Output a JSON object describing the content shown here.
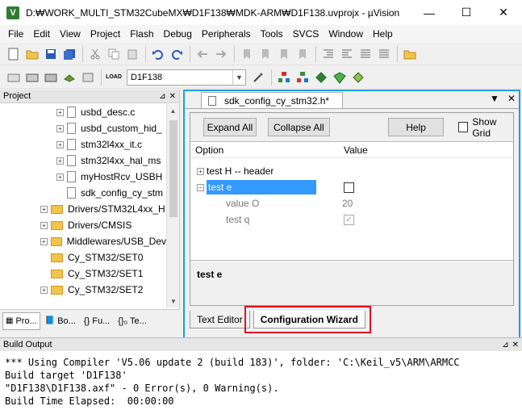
{
  "window": {
    "app_icon": "V",
    "title": "D:₩WORK_MULTI_STM32CubeMX₩D1F138₩MDK-ARM₩D1F138.uvprojx - µVision",
    "minimize": "—",
    "maximize": "☐",
    "close": "✕"
  },
  "menu": [
    "File",
    "Edit",
    "View",
    "Project",
    "Flash",
    "Debug",
    "Peripherals",
    "Tools",
    "SVCS",
    "Window",
    "Help"
  ],
  "toolbar": {
    "target": "D1F138",
    "load_label": "LOAD"
  },
  "project": {
    "title": "Project",
    "pin": "📌",
    "close": "✕",
    "items": [
      {
        "label": "usbd_desc.c",
        "type": "file",
        "expandable": true
      },
      {
        "label": "usbd_custom_hid_",
        "type": "file",
        "expandable": true
      },
      {
        "label": "stm32l4xx_it.c",
        "type": "file",
        "expandable": true
      },
      {
        "label": "stm32l4xx_hal_ms",
        "type": "file",
        "expandable": true
      },
      {
        "label": "myHostRcv_USBH",
        "type": "file",
        "expandable": true
      },
      {
        "label": "sdk_config_cy_stm",
        "type": "file",
        "expandable": false
      },
      {
        "label": "Drivers/STM32L4xx_H",
        "type": "folder",
        "expandable": true
      },
      {
        "label": "Drivers/CMSIS",
        "type": "folder",
        "expandable": true
      },
      {
        "label": "Middlewares/USB_Dev",
        "type": "folder",
        "expandable": true
      },
      {
        "label": "Cy_STM32/SET0",
        "type": "folder",
        "expandable": false
      },
      {
        "label": "Cy_STM32/SET1",
        "type": "folder",
        "expandable": false
      },
      {
        "label": "Cy_STM32/SET2",
        "type": "folder",
        "expandable": true
      }
    ],
    "tabs": [
      "Pro...",
      "Bo...",
      "{} Fu...",
      "{}₀ Te..."
    ]
  },
  "editor": {
    "tab_title": "sdk_config_cy_stm32.h*",
    "buttons": {
      "expand_all": "Expand All",
      "collapse_all": "Collapse All",
      "help": "Help",
      "show_grid": "Show Grid"
    },
    "columns": {
      "option": "Option",
      "value": "Value"
    },
    "rows": [
      {
        "label": "test H  -- header",
        "value": "",
        "toggle": "+"
      },
      {
        "label": "test e",
        "value": "checkbox",
        "toggle": "−"
      },
      {
        "label": "value O",
        "value": "20"
      },
      {
        "label": "test q",
        "value": "checked"
      }
    ],
    "description": "test e",
    "bottom_tabs": {
      "text_editor": "Text Editor",
      "config_wizard": "Configuration Wizard"
    }
  },
  "build": {
    "title": "Build Output",
    "lines": [
      "*** Using Compiler 'V5.06 update 2 (build 183)', folder: 'C:\\Keil_v5\\ARM\\ARMCC",
      "Build target 'D1F138'",
      "\"D1F138\\D1F138.axf\" - 0 Error(s), 0 Warning(s).",
      "Build Time Elapsed:  00:00:00"
    ]
  },
  "colors": {
    "selection": "#3399ff",
    "editor_border": "#1a9ee0",
    "highlight_box": "#e01020"
  }
}
